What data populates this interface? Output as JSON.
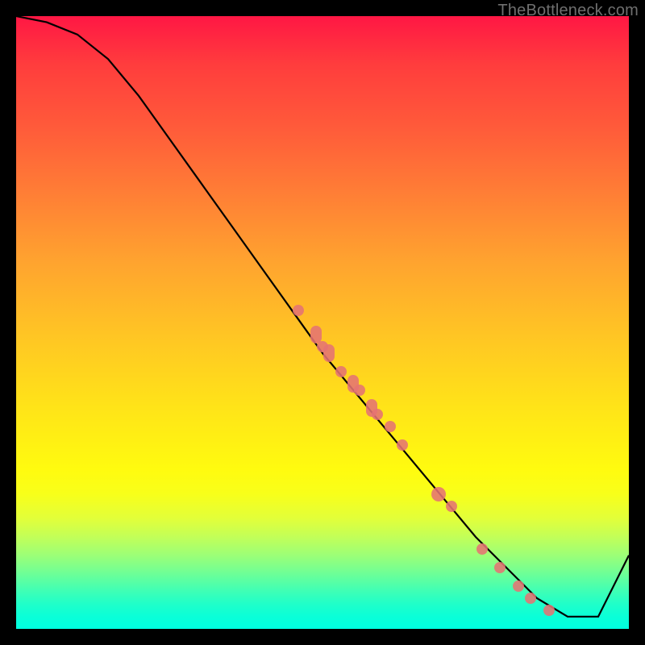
{
  "watermark": "TheBottleneck.com",
  "chart_data": {
    "type": "line",
    "title": "",
    "xlabel": "",
    "ylabel": "",
    "xlim": [
      0,
      100
    ],
    "ylim": [
      0,
      100
    ],
    "grid": false,
    "background_gradient": {
      "direction": "vertical",
      "stops": [
        {
          "pos": 0.0,
          "color": "#ff1744"
        },
        {
          "pos": 0.4,
          "color": "#ffa32f"
        },
        {
          "pos": 0.74,
          "color": "#fffb0f"
        },
        {
          "pos": 1.0,
          "color": "#00ffe0"
        }
      ]
    },
    "series": [
      {
        "name": "curve",
        "type": "line",
        "color": "#000000",
        "x": [
          0,
          5,
          10,
          15,
          20,
          25,
          30,
          35,
          40,
          45,
          50,
          55,
          60,
          65,
          70,
          75,
          80,
          85,
          90,
          95,
          100
        ],
        "y": [
          100,
          99,
          97,
          93,
          87,
          80,
          73,
          66,
          59,
          52,
          45,
          39,
          33,
          27,
          21,
          15,
          10,
          5,
          2,
          2,
          12
        ]
      },
      {
        "name": "markers",
        "type": "scatter",
        "color": "#e57373",
        "points": [
          {
            "x": 46,
            "y": 52,
            "size": "normal"
          },
          {
            "x": 49,
            "y": 48,
            "size": "elong"
          },
          {
            "x": 50,
            "y": 46,
            "size": "normal"
          },
          {
            "x": 51,
            "y": 45,
            "size": "elong"
          },
          {
            "x": 53,
            "y": 42,
            "size": "normal"
          },
          {
            "x": 55,
            "y": 40,
            "size": "elong"
          },
          {
            "x": 56,
            "y": 39,
            "size": "normal"
          },
          {
            "x": 58,
            "y": 36,
            "size": "elong"
          },
          {
            "x": 59,
            "y": 35,
            "size": "normal"
          },
          {
            "x": 61,
            "y": 33,
            "size": "normal"
          },
          {
            "x": 63,
            "y": 30,
            "size": "normal"
          },
          {
            "x": 69,
            "y": 22,
            "size": "big"
          },
          {
            "x": 71,
            "y": 20,
            "size": "normal"
          },
          {
            "x": 76,
            "y": 13,
            "size": "normal"
          },
          {
            "x": 79,
            "y": 10,
            "size": "normal"
          },
          {
            "x": 82,
            "y": 7,
            "size": "normal"
          },
          {
            "x": 84,
            "y": 5,
            "size": "normal"
          },
          {
            "x": 87,
            "y": 3,
            "size": "normal"
          }
        ]
      }
    ]
  }
}
